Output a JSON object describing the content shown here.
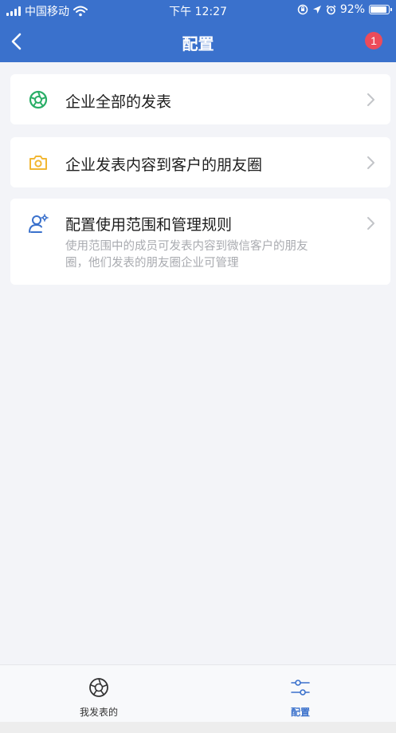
{
  "status_bar": {
    "carrier": "中国移动",
    "time": "下午 12:27",
    "battery_text": "92%",
    "battery_level": 0.92
  },
  "nav": {
    "title": "配置",
    "badge_count": "1"
  },
  "cards": [
    {
      "icon": "shutter-icon",
      "title": "企业全部的发表"
    },
    {
      "icon": "camera-icon",
      "title": "企业发表内容到客户的朋友圈"
    },
    {
      "icon": "user-settings-icon",
      "title": "配置使用范围和管理规则",
      "desc_line1": "使用范围中的成员可发表内容到微信客户的朋友",
      "desc_line2": "圈，他们发表的朋友圈企业可管理"
    }
  ],
  "tabs": [
    {
      "label": "我发表的",
      "icon": "shutter-icon",
      "active": false
    },
    {
      "label": "配置",
      "icon": "sliders-icon",
      "active": true
    }
  ],
  "colors": {
    "header": "#3a71cc",
    "badge": "#ec4b5a",
    "icon_green": "#2aae67",
    "icon_yellow": "#f2b733",
    "icon_blue": "#3a71cc",
    "tab_active": "#3a71cc",
    "tab_inactive": "#333333"
  }
}
